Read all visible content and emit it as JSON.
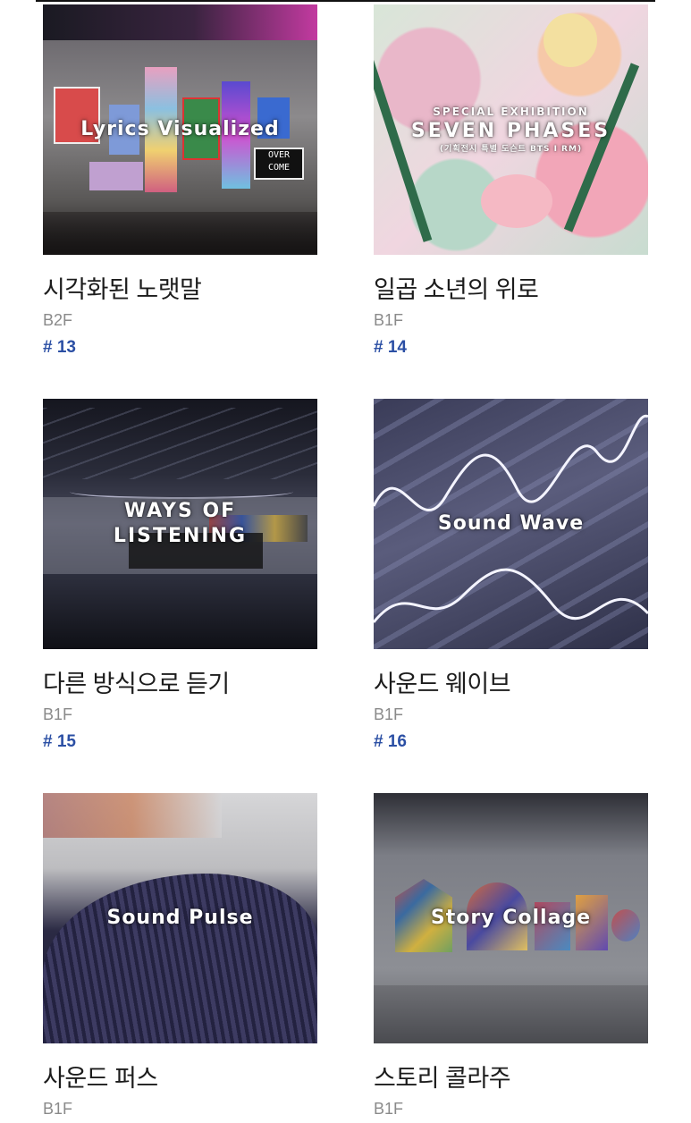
{
  "exhibits": [
    {
      "overlay_lines": [
        "Lyrics Visualized"
      ],
      "title": "시각화된 노랫말",
      "floor": "B2F",
      "number": "# 13"
    },
    {
      "overlay_lines": [
        "SPECIAL EXHIBITION",
        "SEVEN PHASES",
        "(기획전시 특별 도슨트 BTS I RM)"
      ],
      "title": "일곱 소년의 위로",
      "floor": "B1F",
      "number": "# 14"
    },
    {
      "overlay_lines": [
        "WAYS OF",
        "LISTENING"
      ],
      "title": "다른 방식으로 듣기",
      "floor": "B1F",
      "number": "# 15"
    },
    {
      "overlay_lines": [
        "Sound Wave"
      ],
      "title": "사운드 웨이브",
      "floor": "B1F",
      "number": "# 16"
    },
    {
      "overlay_lines": [
        "Sound Pulse"
      ],
      "title": "사운드 퍼스",
      "floor": "B1F"
    },
    {
      "overlay_lines": [
        "Story Collage"
      ],
      "title": "스토리 콜라주",
      "floor": "B1F"
    }
  ],
  "artwork_signs": {
    "overcome_line1": "OVER",
    "overcome_line2": "COME"
  }
}
